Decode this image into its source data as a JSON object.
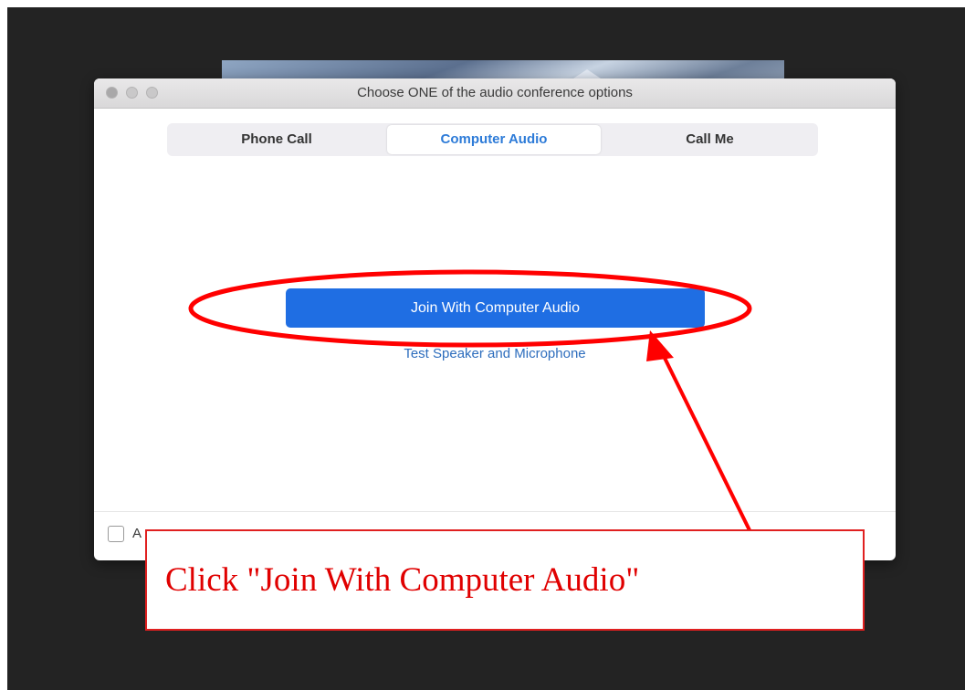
{
  "dialog": {
    "title": "Choose ONE of the audio conference options",
    "tabs": [
      {
        "label": "Phone Call",
        "selected": false
      },
      {
        "label": "Computer Audio",
        "selected": true
      },
      {
        "label": "Call Me",
        "selected": false
      }
    ],
    "join_button_label": "Join With Computer Audio",
    "test_link_label": "Test Speaker and Microphone",
    "footer_checkbox": {
      "visible_label": "A",
      "checked": false
    }
  },
  "annotation": {
    "callout_text": "Click \"Join With Computer Audio\"",
    "color": "#e00000"
  },
  "colors": {
    "accent_blue": "#1f6ee3",
    "selected_tab_text": "#2d7bd8",
    "background": "#232323"
  }
}
